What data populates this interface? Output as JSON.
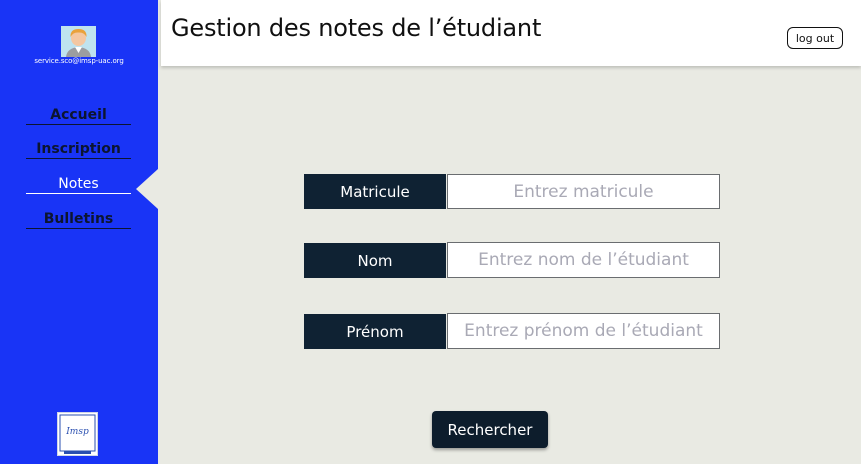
{
  "header": {
    "title": "Gestion des notes de l’étudiant",
    "logout_label": "log out"
  },
  "sidebar": {
    "email": "service.sco@imsp-uac.org",
    "items": [
      {
        "label": "Accueil",
        "active": false
      },
      {
        "label": "Inscription",
        "active": false
      },
      {
        "label": "Notes",
        "active": true
      },
      {
        "label": "Bulletins",
        "active": false
      }
    ],
    "logo_text": "Imsp"
  },
  "form": {
    "matricule": {
      "label": "Matricule",
      "placeholder": "Entrez matricule"
    },
    "nom": {
      "label": "Nom",
      "placeholder": "Entrez nom de l’étudiant"
    },
    "prenom": {
      "label": "Prénom",
      "placeholder": "Entrez prénom de l’étudiant"
    },
    "search_label": "Rechercher"
  },
  "colors": {
    "sidebar": "#1934f6",
    "accent_dark": "#0f2233",
    "background": "#e9eae3"
  }
}
